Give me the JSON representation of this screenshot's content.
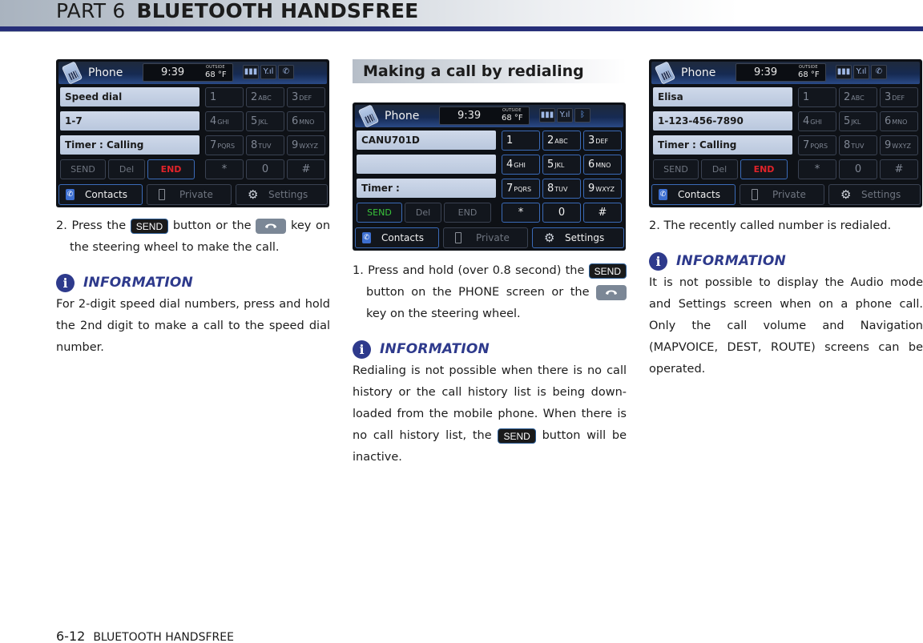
{
  "header": {
    "part": "PART 6",
    "topic": "BLUETOOTH HANDSFREE",
    "accent_color": "#262e78"
  },
  "screens": {
    "common": {
      "app_label": "Phone",
      "time": "9:39",
      "temp_label": "OUTSIDE",
      "temp_value": "68 °F",
      "keypad": [
        {
          "num": "1",
          "sub": ""
        },
        {
          "num": "2",
          "sub": "ABC"
        },
        {
          "num": "3",
          "sub": "DEF"
        },
        {
          "num": "4",
          "sub": "GHI"
        },
        {
          "num": "5",
          "sub": "JKL"
        },
        {
          "num": "6",
          "sub": "MNO"
        },
        {
          "num": "7",
          "sub": "PQRS"
        },
        {
          "num": "8",
          "sub": "TUV"
        },
        {
          "num": "9",
          "sub": "WXYZ"
        },
        {
          "num": "*",
          "sub": ""
        },
        {
          "num": "0",
          "sub": ""
        },
        {
          "num": "#",
          "sub": ""
        }
      ],
      "actions": [
        "SEND",
        "Del",
        "END"
      ],
      "bottom": {
        "contacts": "Contacts",
        "private": "Private",
        "settings": "Settings"
      }
    },
    "speed_dial": {
      "fields": [
        "Speed dial",
        "1-7",
        "Timer : Calling"
      ],
      "status_icons": [
        "battery-icon",
        "signal-icon",
        "call-icon"
      ]
    },
    "redial": {
      "fields": [
        "CANU701D",
        "",
        "Timer :"
      ],
      "status_icons": [
        "battery-icon",
        "signal-icon",
        "bluetooth-icon"
      ]
    },
    "calling": {
      "fields": [
        "Elisa",
        "1-123-456-7890",
        "Timer : Calling"
      ],
      "status_icons": [
        "battery-icon",
        "signal-icon",
        "call-icon"
      ]
    }
  },
  "column1": {
    "step_prefix": "2. Press the",
    "step_mid": "button or the",
    "step_suffix": "key on the steering wheel to make the call.",
    "send_chip": "SEND",
    "info_title": "INFORMATION",
    "info_text": "For 2-digit speed dial numbers, press and hold the 2nd digit to make a call to the speed dial number."
  },
  "column2": {
    "section_title": "Making a call by redialing",
    "step_prefix": "1. Press and hold (over 0.8 second) the",
    "step_mid": "button on the PHONE screen or the",
    "step_suffix": "key on the steering wheel.",
    "send_chip": "SEND",
    "info_title": "INFORMATION",
    "info_text_1": "Redialing is not possible when there is no call history or the call history list is being down-loaded from the mobile phone. When there is no call history list, the",
    "info_text_2": "button will be inactive."
  },
  "column3": {
    "step": "2. The recently called number is redialed.",
    "info_title": "INFORMATION",
    "info_text": "It is not possible to display the Audio mode and Settings screen when on a phone call. Only the call volume and Navigation (MAPVOICE, DEST, ROUTE) screens can be operated."
  },
  "footer": {
    "page_number": "6-12",
    "section": "BLUETOOTH HANDSFREE"
  }
}
